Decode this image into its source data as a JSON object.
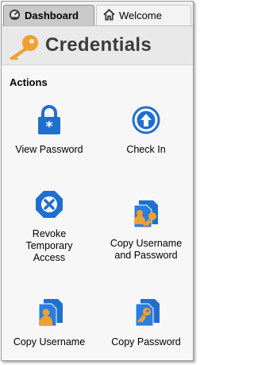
{
  "tabs": [
    {
      "label": "Dashboard",
      "icon": "dashboard-gauge-icon",
      "active": true
    },
    {
      "label": "Welcome",
      "icon": "home-icon",
      "active": false
    }
  ],
  "header": {
    "title": "Credentials",
    "icon": "key-icon"
  },
  "section": {
    "label": "Actions"
  },
  "actions": [
    {
      "label": "View Password",
      "icon": "lock-icon"
    },
    {
      "label": "Check In",
      "icon": "check-in-arrow-icon"
    },
    {
      "label": "Revoke\nTemporary\nAccess",
      "icon": "revoke-x-icon"
    },
    {
      "label": "Copy Username\nand Password",
      "icon": "copy-username-password-icon"
    },
    {
      "label": "Copy Username",
      "icon": "copy-username-icon"
    },
    {
      "label": "Copy Password",
      "icon": "copy-password-icon"
    }
  ],
  "colors": {
    "accent_blue": "#1f6fd1",
    "key_orange": "#f0a030"
  }
}
